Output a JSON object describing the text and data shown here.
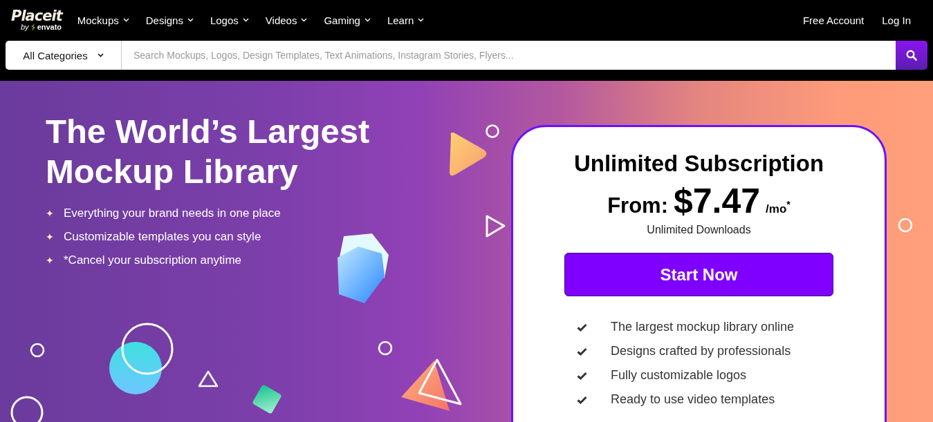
{
  "logo": {
    "name": "Placeit",
    "by": "by",
    "brand": "envato"
  },
  "nav": [
    {
      "label": "Mockups"
    },
    {
      "label": "Designs"
    },
    {
      "label": "Logos"
    },
    {
      "label": "Videos"
    },
    {
      "label": "Gaming"
    },
    {
      "label": "Learn"
    }
  ],
  "account_links": [
    "Free Account",
    "Log In"
  ],
  "search": {
    "category": "All Categories",
    "placeholder": "Search Mockups, Logos, Design Templates, Text Animations, Instagram Stories, Flyers..."
  },
  "hero": {
    "title": "The World’s Largest Mockup Library",
    "bullets": [
      {
        "icon": "✦",
        "text": "Everything your brand needs in one place"
      },
      {
        "icon": "✦",
        "text": "Customizable templates you can style"
      },
      {
        "icon": "✦",
        "text": "*Cancel your subscription anytime"
      }
    ]
  },
  "plan": {
    "title": "Unlimited Subscription",
    "price_prefix": "From:",
    "price": "$7.47",
    "period": "/mo$^{*}$",
    "subtitle": "Unlimited Downloads",
    "button": "Start Now",
    "features": [
      "The largest mockup library online",
      "Designs crafted by professionals",
      "Fully customizable logos",
      "Ready to use video templates"
    ]
  }
}
